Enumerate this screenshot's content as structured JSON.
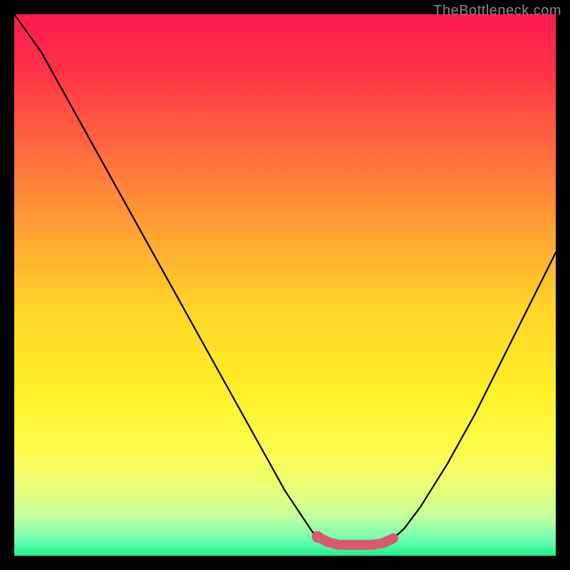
{
  "watermark": {
    "text": "TheBottleneck.com"
  },
  "chart_data": {
    "type": "line",
    "title": "",
    "xlabel": "",
    "ylabel": "",
    "x_range": [
      0,
      100
    ],
    "y_range": [
      0,
      100
    ],
    "series": [
      {
        "name": "bottleneck-curve",
        "x": [
          0,
          5,
          10,
          15,
          20,
          25,
          30,
          35,
          40,
          45,
          50,
          55,
          56,
          58,
          60,
          62,
          64,
          66,
          68,
          70,
          72,
          75,
          80,
          85,
          90,
          95,
          100
        ],
        "y": [
          100,
          93,
          84,
          75,
          66,
          57,
          48,
          39,
          30,
          21,
          12,
          4.5,
          3.5,
          2.5,
          2,
          2,
          2,
          2,
          2.3,
          3.2,
          5,
          9,
          17,
          26,
          36,
          46,
          56
        ]
      }
    ],
    "highlight": {
      "name": "optimal-range",
      "x": [
        56,
        58,
        60,
        62,
        64,
        66,
        68,
        70
      ],
      "y": [
        3.5,
        2.5,
        2,
        2,
        2,
        2,
        2.3,
        3.2
      ]
    },
    "background_gradient": {
      "stops": [
        {
          "pos": 0.0,
          "color": "#ff1a4f"
        },
        {
          "pos": 0.1,
          "color": "#ff3149"
        },
        {
          "pos": 0.25,
          "color": "#ff6a3e"
        },
        {
          "pos": 0.4,
          "color": "#ffa233"
        },
        {
          "pos": 0.55,
          "color": "#ffd628"
        },
        {
          "pos": 0.7,
          "color": "#fff028"
        },
        {
          "pos": 0.8,
          "color": "#fdfc4b"
        },
        {
          "pos": 0.88,
          "color": "#eaff7a"
        },
        {
          "pos": 0.93,
          "color": "#bfffa0"
        },
        {
          "pos": 0.97,
          "color": "#6fffb0"
        },
        {
          "pos": 1.0,
          "color": "#1cf28f"
        }
      ]
    }
  }
}
